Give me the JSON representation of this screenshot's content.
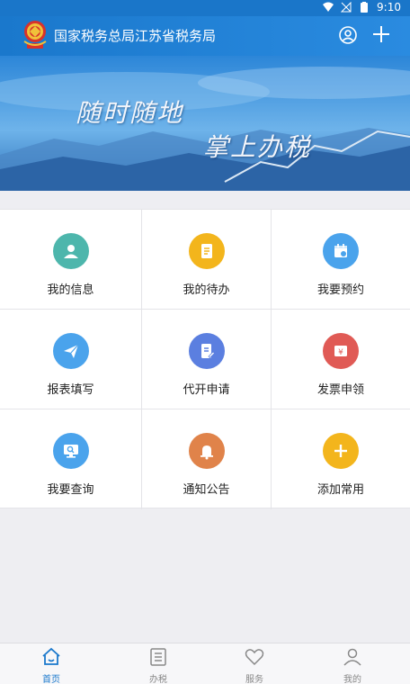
{
  "status_bar": {
    "time": "9:10"
  },
  "header": {
    "title": "国家税务总局江苏省税务局",
    "logo_icon": "tax-emblem-icon",
    "user_icon": "user-circle-icon",
    "add_icon": "plus-icon"
  },
  "banner": {
    "line1": "随时随地",
    "line2": "掌上办税"
  },
  "grid": [
    {
      "label": "我的信息",
      "icon": "person-icon",
      "color": "#4db6ac"
    },
    {
      "label": "我的待办",
      "icon": "document-icon",
      "color": "#f3b51c"
    },
    {
      "label": "我要预约",
      "icon": "calendar-icon",
      "color": "#4aa3ec"
    },
    {
      "label": "报表填写",
      "icon": "paper-plane-icon",
      "color": "#4aa3ec"
    },
    {
      "label": "代开申请",
      "icon": "edit-document-icon",
      "color": "#5b7fe0"
    },
    {
      "label": "发票申领",
      "icon": "invoice-icon",
      "color": "#e05a55"
    },
    {
      "label": "我要查询",
      "icon": "monitor-search-icon",
      "color": "#4aa3ec"
    },
    {
      "label": "通知公告",
      "icon": "bell-icon",
      "color": "#e0834a"
    },
    {
      "label": "添加常用",
      "icon": "plus-icon",
      "color": "#f3b51c"
    }
  ],
  "tabs": [
    {
      "label": "首页",
      "icon": "home-icon",
      "active": true
    },
    {
      "label": "办税",
      "icon": "list-icon",
      "active": false
    },
    {
      "label": "服务",
      "icon": "heart-icon",
      "active": false
    },
    {
      "label": "我的",
      "icon": "profile-icon",
      "active": false
    }
  ],
  "colors": {
    "primary": "#1a78cc",
    "background": "#eeeef2",
    "tab_active": "#1a78cc",
    "tab_inactive": "#888888"
  }
}
